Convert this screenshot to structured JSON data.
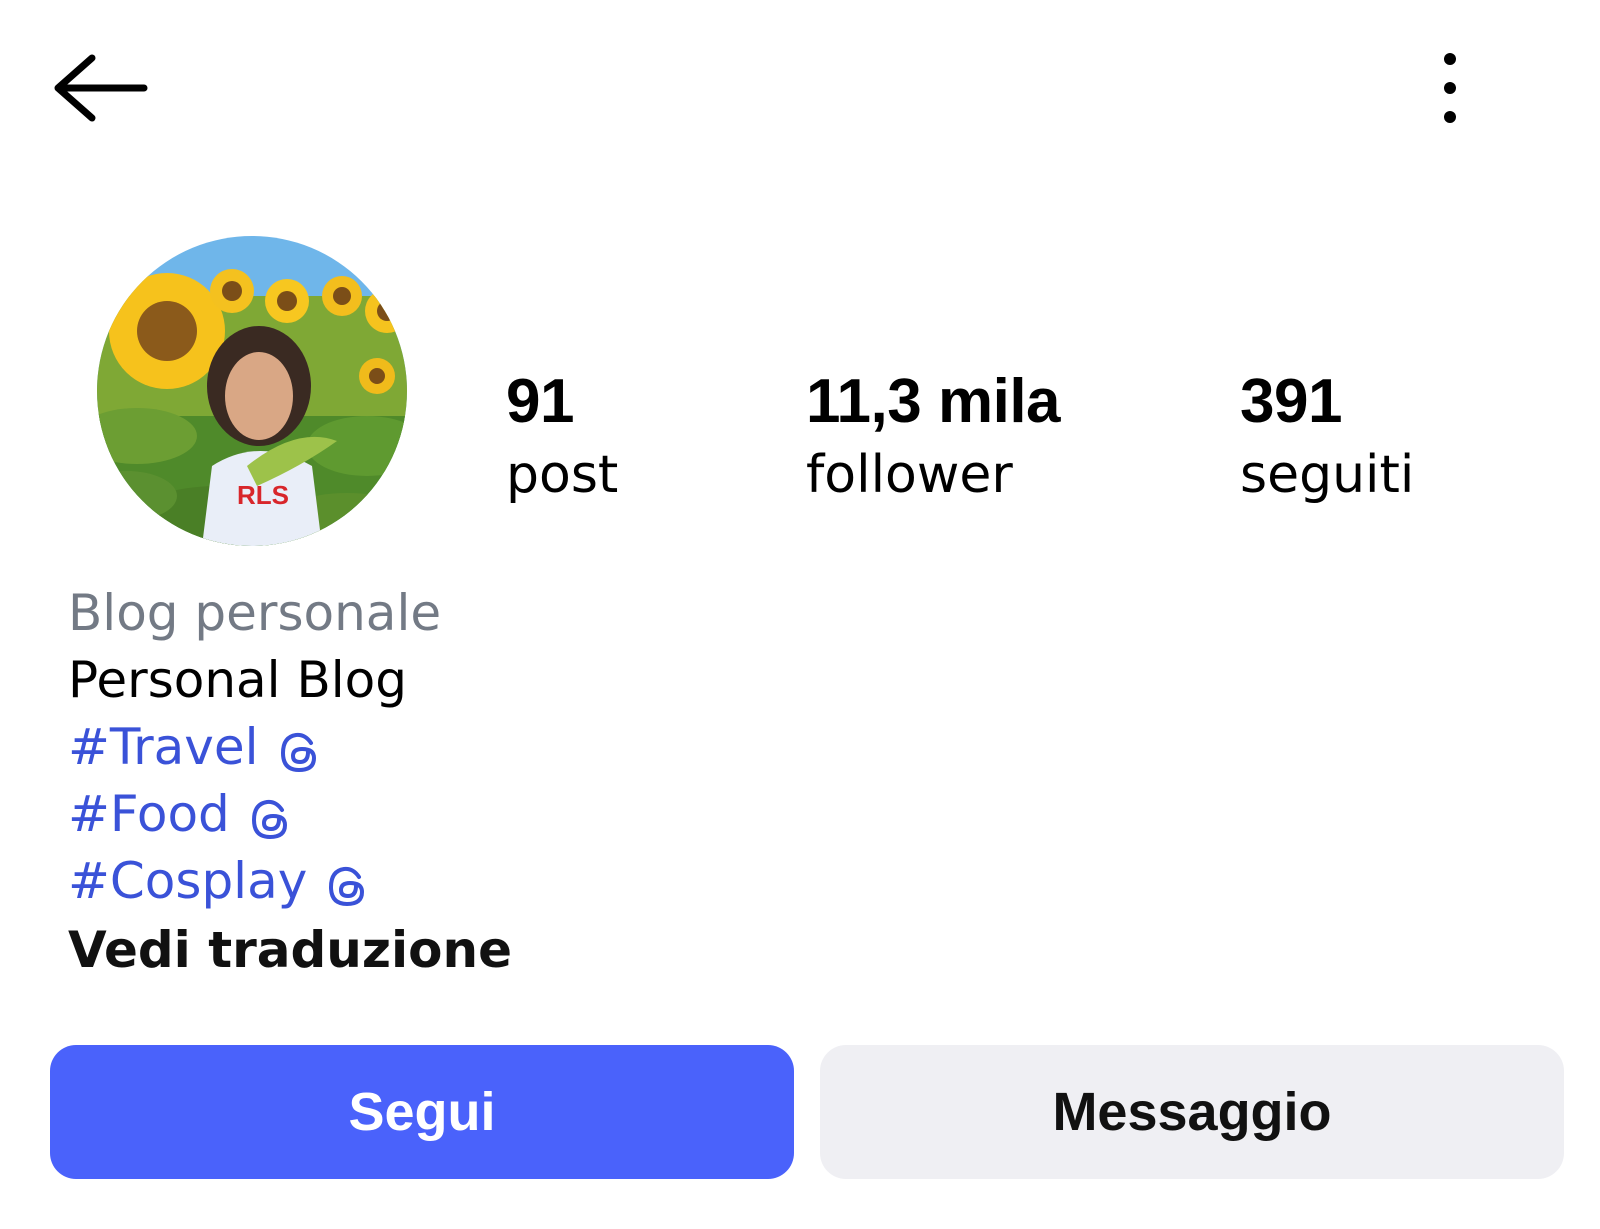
{
  "header": {
    "back_icon": "arrow-left-icon",
    "more_icon": "more-vertical-icon"
  },
  "profile": {
    "avatar_description_icon": "profile-photo",
    "stats": [
      {
        "value": "91",
        "label": "post"
      },
      {
        "value": "11,3 mila",
        "label": "follower"
      },
      {
        "value": "391",
        "label": "seguiti"
      }
    ]
  },
  "bio": {
    "category": "Blog personale",
    "text": "Personal Blog",
    "hashtags": [
      "#Travel",
      "#Food",
      "#Cosplay"
    ],
    "hashtag_icon": "threads-icon",
    "translate_label": "Vedi traduzione"
  },
  "actions": {
    "follow_label": "Segui",
    "message_label": "Messaggio"
  },
  "colors": {
    "accent": "#4a62fb",
    "hashtag": "#3a52d8",
    "category": "#737a85",
    "secondary_button": "#efeff3"
  }
}
